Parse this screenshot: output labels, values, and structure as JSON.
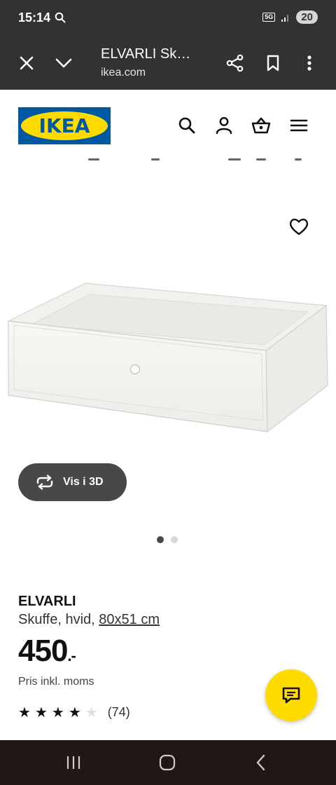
{
  "status_bar": {
    "time": "15:14",
    "network": "5G",
    "battery": "20"
  },
  "browser": {
    "page_title": "ELVARLI Sk…",
    "domain": "ikea.com"
  },
  "brand": {
    "logo_text": "IKEA",
    "blue": "#0058a3",
    "yellow": "#ffdb00"
  },
  "gallery": {
    "view3d_label": "Vis i 3D",
    "dots": 2,
    "active_dot": 1
  },
  "product": {
    "name": "ELVARLI",
    "description": "Skuffe, hvid,",
    "size": "80x51 cm",
    "price": "450",
    "price_suffix": ".-",
    "price_note": "Pris inkl. moms",
    "rating": 4,
    "rating_max": 5,
    "review_count": "(74)"
  },
  "icons": {
    "status": "search-icon",
    "browser": [
      "close-icon",
      "chevron-down-icon",
      "share-icon",
      "bookmark-icon",
      "more-vert-icon"
    ],
    "header": [
      "search-icon",
      "user-icon",
      "basket-icon",
      "menu-icon"
    ],
    "favorite": "heart-icon",
    "view3d": "rotate-3d-icon",
    "chat": "chat-icon",
    "nav": [
      "recents-icon",
      "home-icon",
      "back-icon"
    ]
  }
}
